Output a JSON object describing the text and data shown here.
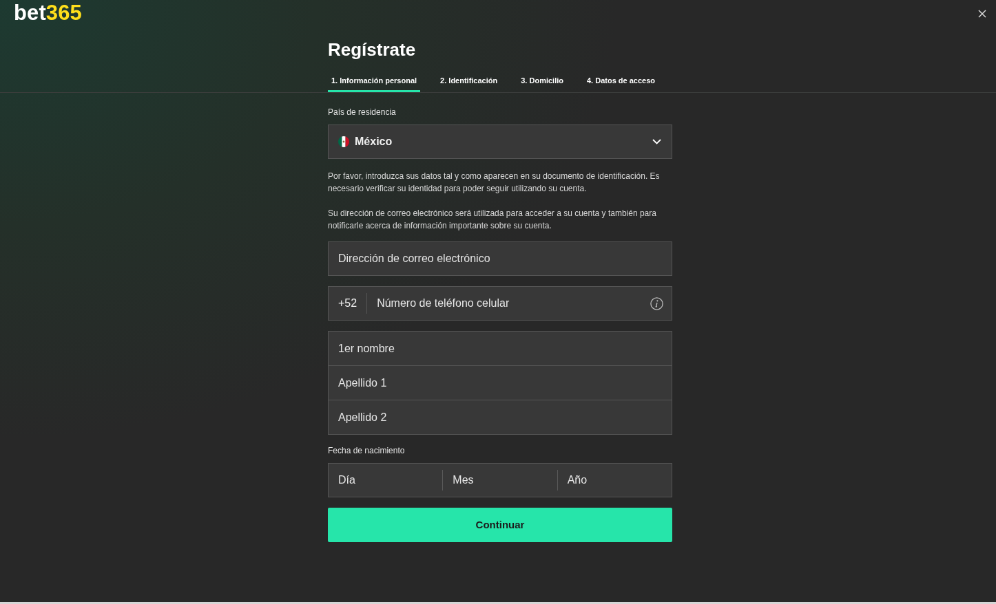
{
  "header": {
    "logo": {
      "text": "bet",
      "accent": "365"
    }
  },
  "title": "Regístrate",
  "steps": [
    {
      "label": "1. Información personal",
      "selected": true
    },
    {
      "label": "2. Identificación",
      "selected": false
    },
    {
      "label": "3. Domicilio",
      "selected": false
    },
    {
      "label": "4. Datos de acceso",
      "selected": false
    }
  ],
  "country": {
    "label": "País de residencia",
    "value": "México"
  },
  "notes": [
    "Por favor, introduzca sus datos tal y como aparecen en su documento de identificación. Es necesario verificar su identidad para poder seguir utilizando su cuenta.",
    "Su dirección de correo electrónico será utilizada para acceder a su cuenta y también para notificarle acerca de información importante sobre su cuenta."
  ],
  "email": {
    "placeholder": "Dirección de correo electrónico"
  },
  "phone": {
    "prefix": "+52",
    "placeholder": "Número de teléfono celular"
  },
  "names": [
    {
      "placeholder": "1er nombre"
    },
    {
      "placeholder": "Apellido 1"
    },
    {
      "placeholder": "Apellido 2"
    }
  ],
  "birth_date": {
    "label": "Fecha de nacimiento",
    "parts": [
      {
        "placeholder": "Día"
      },
      {
        "placeholder": "Mes"
      },
      {
        "placeholder": "Año"
      }
    ]
  },
  "continue_button": "Continuar"
}
